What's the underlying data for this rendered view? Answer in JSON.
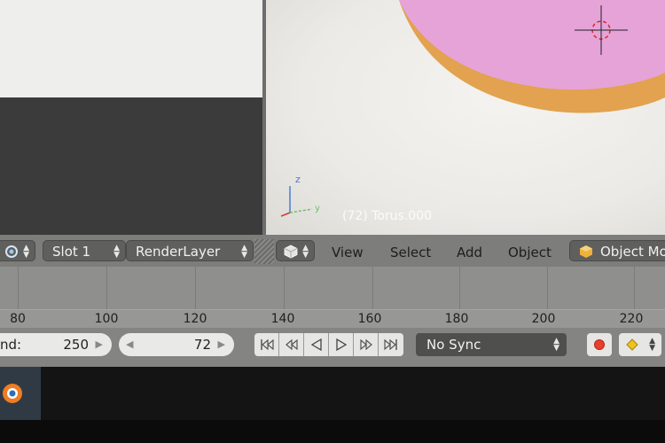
{
  "viewport": {
    "object_label": "(72) Torus.000",
    "axis_z": "z",
    "axis_y": "y"
  },
  "header": {
    "left_button_icon": "render-icon",
    "slot_label": "Slot 1",
    "render_layer_label": "RenderLayer",
    "viewport_type_icon": "cube-icon",
    "menu": [
      "View",
      "Select",
      "Add",
      "Object"
    ],
    "mode_label": "Object Mo"
  },
  "timeline": {
    "ticks": [
      "80",
      "100",
      "120",
      "140",
      "160",
      "180",
      "200",
      "220"
    ]
  },
  "playback": {
    "end_label": "nd:",
    "end_value": "250",
    "current_frame": "72",
    "sync_label": "No Sync",
    "colors": {
      "record": "#e8402c",
      "keyframe": "#f0c21c"
    }
  },
  "colors": {
    "frosting": "#e6a3d8",
    "donut": "#e2a24f"
  }
}
